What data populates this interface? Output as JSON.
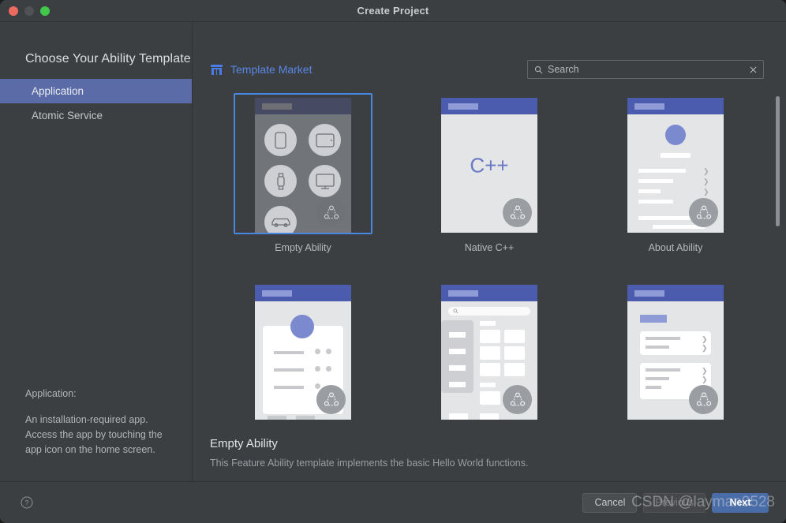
{
  "window": {
    "title": "Create Project",
    "traffic_lights": [
      "close-red",
      "minimize-gray",
      "maximize-green"
    ]
  },
  "left_pane": {
    "title": "Choose Your Ability Template",
    "items": [
      {
        "label": "Application",
        "selected": true
      },
      {
        "label": "Atomic Service",
        "selected": false
      }
    ],
    "description_heading": "Application:",
    "description_body": "An installation-required app. Access the app by touching the app icon on the home screen."
  },
  "toolbar": {
    "market_label": "Template Market",
    "market_icon": "storefront-icon",
    "market_color": "#5a86e8",
    "search": {
      "icon": "search-icon",
      "placeholder": "Search",
      "value": "",
      "clear_icon": "close-x-icon"
    }
  },
  "templates": [
    {
      "id": "empty-ability",
      "label": "Empty Ability",
      "selected": true,
      "style": "devices"
    },
    {
      "id": "native-cpp",
      "label": "Native C++",
      "selected": false,
      "style": "cpp",
      "logo_text": "C++"
    },
    {
      "id": "about-ability",
      "label": "About Ability",
      "selected": false,
      "style": "about"
    },
    {
      "id": "profile-ability",
      "label": "",
      "selected": false,
      "style": "profile"
    },
    {
      "id": "category-ability",
      "label": "",
      "selected": false,
      "style": "category"
    },
    {
      "id": "settings-ability",
      "label": "",
      "selected": false,
      "style": "settings"
    }
  ],
  "detail": {
    "title": "Empty Ability",
    "description": "This Feature Ability template implements the basic Hello World functions."
  },
  "footer": {
    "help_icon": "question-circle-icon",
    "buttons": [
      {
        "label": "Cancel",
        "kind": "normal"
      },
      {
        "label": "Previous",
        "kind": "disabled"
      },
      {
        "label": "Next",
        "kind": "primary"
      }
    ]
  },
  "watermark": "CSDN @layman0528",
  "colors": {
    "accent_blue": "#4a88e0",
    "selection_blue": "#5b6ba8",
    "primary_button": "#4a6da8",
    "window_bg": "#3c3f41"
  }
}
